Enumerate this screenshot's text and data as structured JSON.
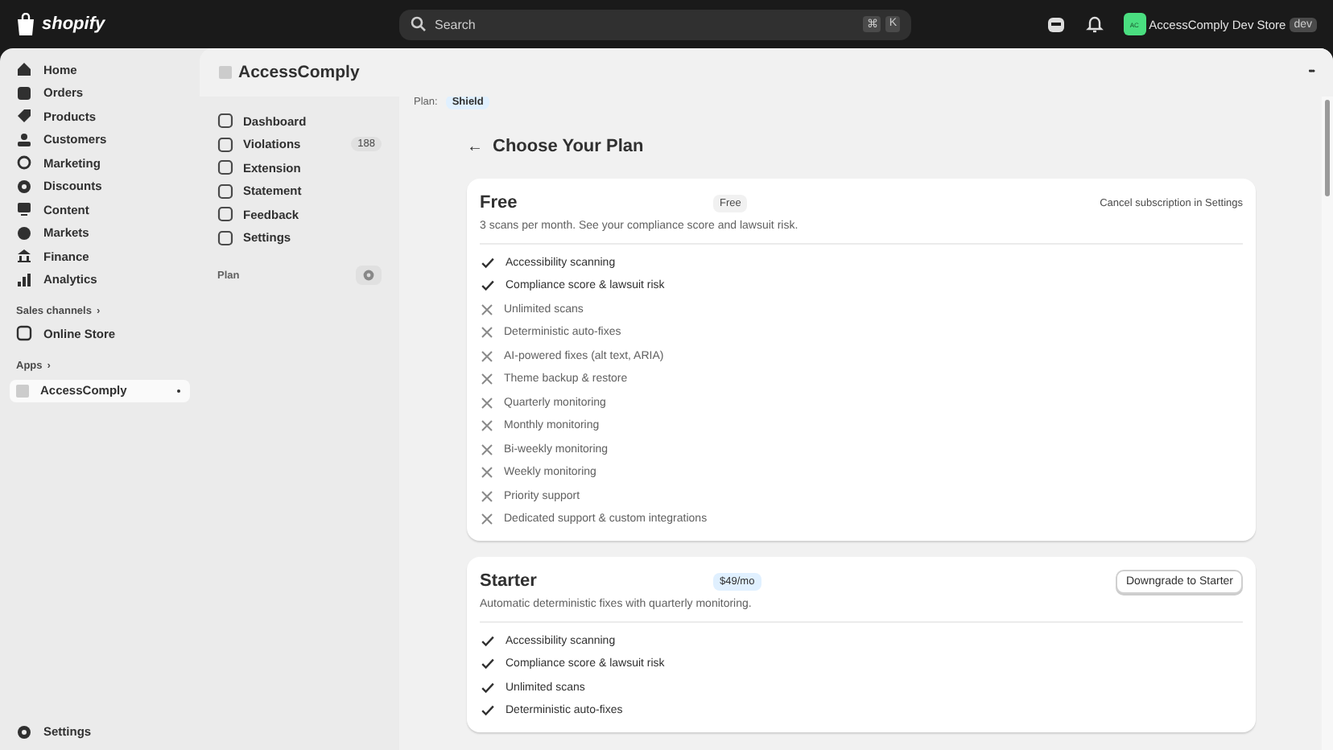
{
  "topbar": {
    "brand": "shopify",
    "search": {
      "placeholder": "Search"
    },
    "shortcut": [
      "⌘",
      "K"
    ],
    "store": {
      "initials": "AC",
      "name": "AccessComply Dev Store",
      "badge": "dev"
    }
  },
  "sidebar": {
    "items": [
      {
        "label": "Home",
        "selected": false
      },
      {
        "label": "Orders",
        "selected": false
      },
      {
        "label": "Products",
        "selected": false
      },
      {
        "label": "Customers",
        "selected": false
      },
      {
        "label": "Marketing",
        "selected": false
      },
      {
        "label": "Discounts",
        "selected": false
      },
      {
        "label": "Content",
        "selected": false
      },
      {
        "label": "Markets",
        "selected": false
      },
      {
        "label": "Finance",
        "selected": false
      },
      {
        "label": "Analytics",
        "selected": false
      }
    ],
    "sales_channels": {
      "label": "Sales channels",
      "chevron": "›",
      "items": [
        {
          "label": "Online Store",
          "selected": false
        }
      ]
    },
    "apps": {
      "label": "Apps",
      "chevron": "›",
      "items": [
        {
          "label": "AccessComply",
          "selected": true
        }
      ]
    },
    "footer": "Settings"
  },
  "app": {
    "title": "AccessComply",
    "more": "•••",
    "nav": [
      {
        "label": "Dashboard"
      },
      {
        "label": "Violations",
        "count": "188"
      },
      {
        "label": "Extension"
      },
      {
        "label": "Statement"
      },
      {
        "label": "Feedback"
      },
      {
        "label": "Settings"
      }
    ],
    "nav_section": "Plan",
    "plan_label": "Plan:",
    "plan_badge": "Shield",
    "back": "←",
    "heading": "Choose Your Plan",
    "plans": [
      {
        "name": "Free",
        "price": "Free",
        "action": "Cancel subscription in Settings",
        "description": "3 scans per month. See your compliance score and lawsuit risk.",
        "features": [
          {
            "label": "Accessibility scanning",
            "included": true
          },
          {
            "label": "Compliance score & lawsuit risk",
            "included": true
          },
          {
            "label": "Unlimited scans",
            "included": false
          },
          {
            "label": "Deterministic auto-fixes",
            "included": false
          },
          {
            "label": "AI-powered fixes (alt text, ARIA)",
            "included": false
          },
          {
            "label": "Theme backup & restore",
            "included": false
          },
          {
            "label": "Quarterly monitoring",
            "included": false
          },
          {
            "label": "Monthly monitoring",
            "included": false
          },
          {
            "label": "Bi-weekly monitoring",
            "included": false
          },
          {
            "label": "Weekly monitoring",
            "included": false
          },
          {
            "label": "Priority support",
            "included": false
          },
          {
            "label": "Dedicated support & custom integrations",
            "included": false
          }
        ]
      },
      {
        "name": "Starter",
        "price": "$49/mo",
        "action": "Downgrade to Starter",
        "description": "Automatic deterministic fixes with quarterly monitoring.",
        "features": [
          {
            "label": "Accessibility scanning",
            "included": true
          },
          {
            "label": "Compliance score & lawsuit risk",
            "included": true
          },
          {
            "label": "Unlimited scans",
            "included": true
          },
          {
            "label": "Deterministic auto-fixes",
            "included": true
          }
        ]
      }
    ]
  }
}
